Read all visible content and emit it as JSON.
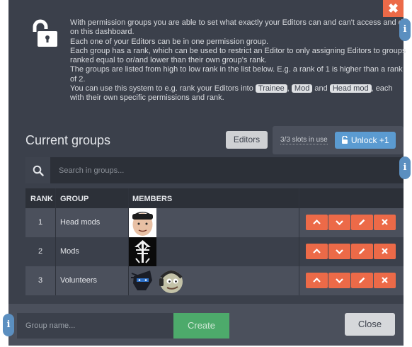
{
  "intro": {
    "lines": [
      "With permission groups you are able to set what exactly your Editors can and can't access and do on this dashboard.",
      "Each one of your Editors can be in one permission group.",
      "Each group has a rank, which can be used to restrict an Editor to only assigning Editors to groups ranked equal to or/and lower than their own group's rank.",
      "The groups are listed from high to low rank in the list below. E.g. a rank of 1 is higher than a rank of 2."
    ],
    "example_prefix": "You can use this system to e.g. rank your Editors into",
    "chip_trainee": "Trainee",
    "comma": ",",
    "chip_mod": "Mod",
    "and": "and",
    "chip_headmod": "Head mod",
    "example_suffix": ", each with their own specific permissions and rank."
  },
  "header": {
    "title": "Current groups",
    "editors_label": "Editors",
    "slots_text": "3/3 slots in use",
    "unlock_label": "Unlock +1"
  },
  "search": {
    "placeholder": "Search in groups..."
  },
  "table": {
    "columns": [
      "RANK",
      "GROUP",
      "MEMBERS"
    ],
    "rows": [
      {
        "rank": "1",
        "group": "Head mods"
      },
      {
        "rank": "2",
        "group": "Mods"
      },
      {
        "rank": "3",
        "group": "Volunteers"
      }
    ]
  },
  "footer": {
    "group_placeholder": "Group name...",
    "create_label": "Create",
    "close_label": "Close"
  },
  "info_label": "i",
  "close_x": "✖",
  "colors": {
    "accent_orange": "#ec6a48",
    "accent_blue": "#5b9bd1",
    "accent_green": "#4daa6b",
    "panel": "#3b404b"
  }
}
